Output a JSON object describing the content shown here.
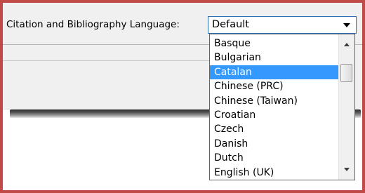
{
  "form": {
    "label": "Citation and Bibliography Language:",
    "select_value": "Default"
  },
  "dropdown": {
    "options": [
      "Basque",
      "Bulgarian",
      "Catalan",
      "Chinese (PRC)",
      "Chinese (Taiwan)",
      "Croatian",
      "Czech",
      "Danish",
      "Dutch",
      "English (UK)"
    ],
    "highlighted_option": "Catalan"
  },
  "colors": {
    "frame_border": "#bf4a46",
    "selection": "#3399ff",
    "select_border": "#2f6fb5"
  }
}
